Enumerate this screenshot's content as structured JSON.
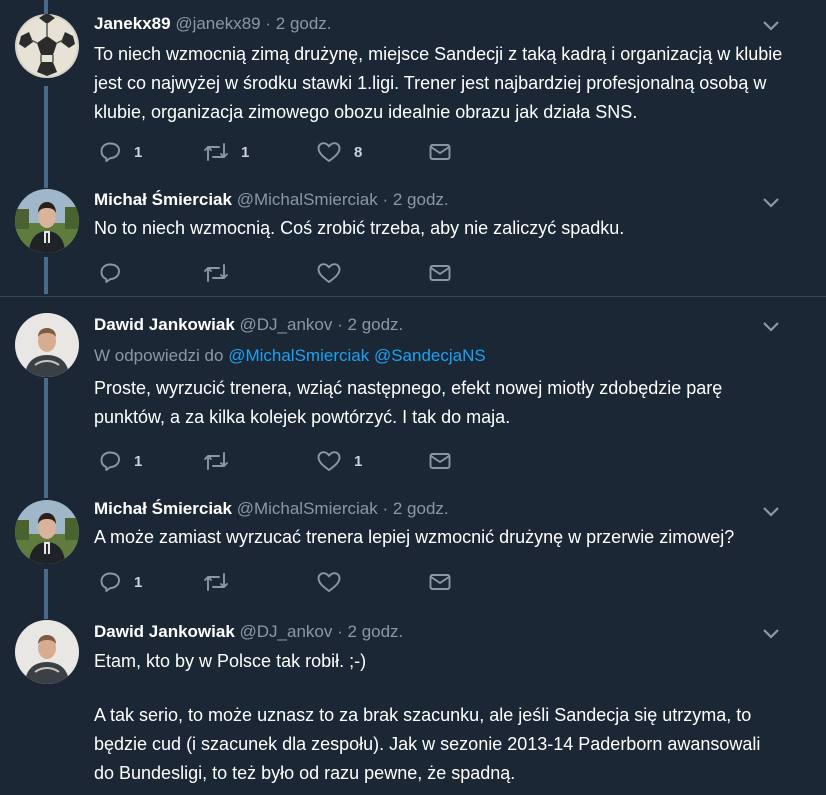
{
  "tweets": [
    {
      "name": "Janekx89",
      "handle": "@janekx89",
      "dot": "·",
      "time": "2 godz.",
      "text": "To niech wzmocnią zimą drużynę, miejsce Sandecji z taką kadrą i organizacją w klubie jest co najwyżej w środku stawki 1.ligi. Trener jest najbardziej profesjonalną osobą w klubie, organizacja zimowego obozu idealnie obrazu jak działa SNS.",
      "replies": "1",
      "retweets": "1",
      "likes": "8"
    },
    {
      "name": "Michał Śmierciak",
      "handle": "@MichalSmierciak",
      "dot": "·",
      "time": "2 godz.",
      "text": "No to niech wzmocnią. Coś zrobić trzeba, aby nie zaliczyć spadku.",
      "replies": "",
      "retweets": "",
      "likes": ""
    },
    {
      "name": "Dawid Jankowiak",
      "handle": "@DJ_ankov",
      "dot": "·",
      "time": "2 godz.",
      "reply_prefix": "W odpowiedzi do",
      "reply_mention_1": "@MichalSmierciak",
      "reply_mention_2": "@SandecjaNS",
      "text": "Proste, wyrzucić trenera, wziąć następnego, efekt nowej miotły zdobędzie parę punktów, a za kilka kolejek powtórzyć. I tak do maja.",
      "replies": "1",
      "retweets": "",
      "likes": "1"
    },
    {
      "name": "Michał Śmierciak",
      "handle": "@MichalSmierciak",
      "dot": "·",
      "time": "2 godz.",
      "text": "A może zamiast wyrzucać trenera lepiej wzmocnić drużynę w przerwie zimowej?",
      "replies": "1",
      "retweets": "",
      "likes": ""
    },
    {
      "name": "Dawid Jankowiak",
      "handle": "@DJ_ankov",
      "dot": "·",
      "time": "2 godz.",
      "text": "Etam, kto by w Polsce tak robił. ;-)",
      "text_2": "A tak serio, to może uznasz to za brak szacunku, ale jeśli Sandecja się utrzyma, to będzie cud (i szacunek dla zespołu). Jak w sezonie 2013-14 Paderborn awansowali do Bundesligi, to też było od razu pewne, że spadną."
    }
  ],
  "icons": {
    "reply": "reply-icon",
    "retweet": "retweet-icon",
    "like": "heart-icon",
    "dm": "envelope-icon",
    "more": "chevron-down-icon"
  },
  "colors": {
    "background": "#1b2734",
    "text": "#ffffff",
    "muted": "#8899a6",
    "link": "#1da1f2",
    "thread_line": "#4a6a8a"
  }
}
